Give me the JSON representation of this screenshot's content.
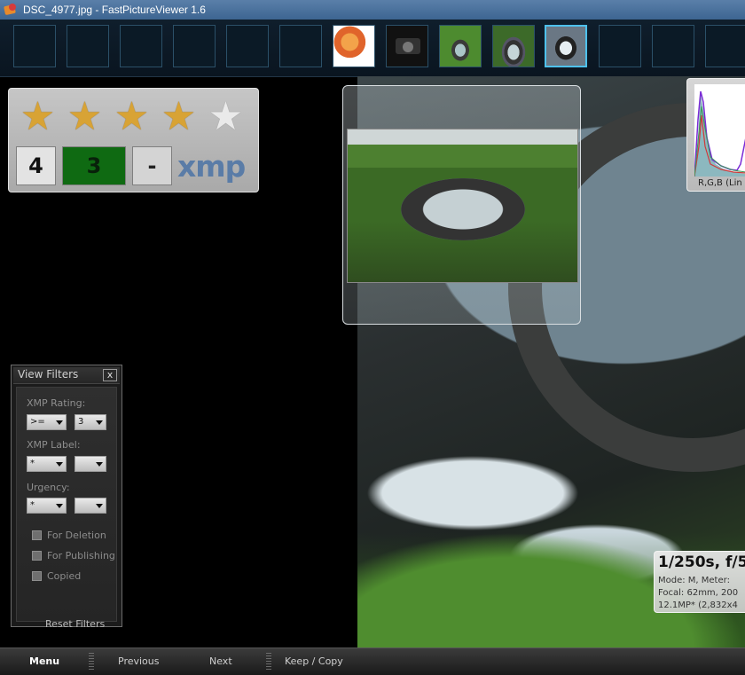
{
  "window": {
    "title": "DSC_4977.jpg - FastPictureViewer 1.6"
  },
  "rating": {
    "stars": 4,
    "max_stars": 5,
    "box1": "4",
    "box2": "3",
    "box3": "-",
    "xmp_logo": "xmp"
  },
  "histogram": {
    "caption": "R,G,B (Lin"
  },
  "exif": {
    "main": "1/250s, f/5",
    "line1": "Mode: M, Meter:",
    "line2": "Focal: 62mm, 200",
    "line3": "12.1MP* (2,832x4"
  },
  "view_filters": {
    "title": "View Filters",
    "close": "x",
    "xmp_rating_label": "XMP Rating:",
    "xmp_rating_op": ">=",
    "xmp_rating_value": "3",
    "xmp_label_label": "XMP Label:",
    "xmp_label_value": "*",
    "xmp_label_value2": "",
    "urgency_label": "Urgency:",
    "urgency_value": "*",
    "urgency_value2": "",
    "for_deletion": "For Deletion",
    "for_publishing": "For Publishing",
    "copied": "Copied",
    "reset": "Reset Filters"
  },
  "bottom": {
    "menu": "Menu",
    "previous": "Previous",
    "next": "Next",
    "keep_copy": "Keep / Copy"
  },
  "icons": [
    "app-icon",
    "star-icon",
    "close-icon",
    "dropdown-arrow-icon",
    "checkbox-icon"
  ]
}
